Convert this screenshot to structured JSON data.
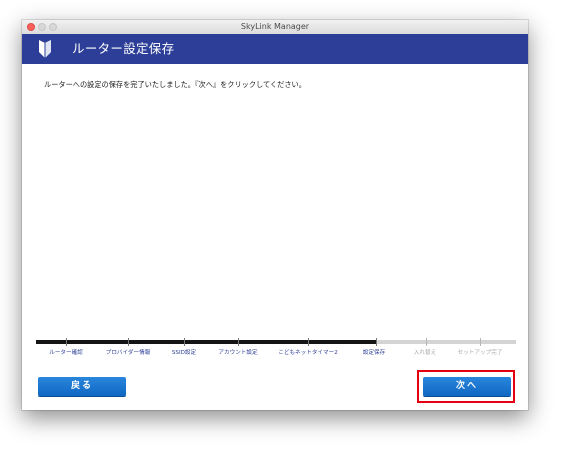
{
  "window": {
    "title": "SkyLink Manager"
  },
  "header": {
    "title": "ルーター設定保存",
    "icon": "beginner-shield-icon",
    "background": "#2c3e97"
  },
  "main": {
    "message": "ルーターへの設定の保存を完了いたしました。『次へ』をクリックしてください。"
  },
  "progress": {
    "completed_fraction": 0.71,
    "current_step": "設定保存",
    "steps": [
      {
        "label": "ルーター確認",
        "state": "done"
      },
      {
        "label": "プロバイダー情報",
        "state": "done"
      },
      {
        "label": "SSID設定",
        "state": "done"
      },
      {
        "label": "アカウント設定",
        "state": "done"
      },
      {
        "label": "こどもネットタイマー2",
        "state": "done"
      },
      {
        "label": "設定保存",
        "state": "current"
      },
      {
        "label": "入れ替え",
        "state": "future"
      },
      {
        "label": "セットアップ完了",
        "state": "future"
      }
    ]
  },
  "buttons": {
    "back_label": "戻る",
    "next_label": "次へ",
    "color": "#1675d0"
  },
  "annotation": {
    "highlight_color": "#e60012"
  }
}
